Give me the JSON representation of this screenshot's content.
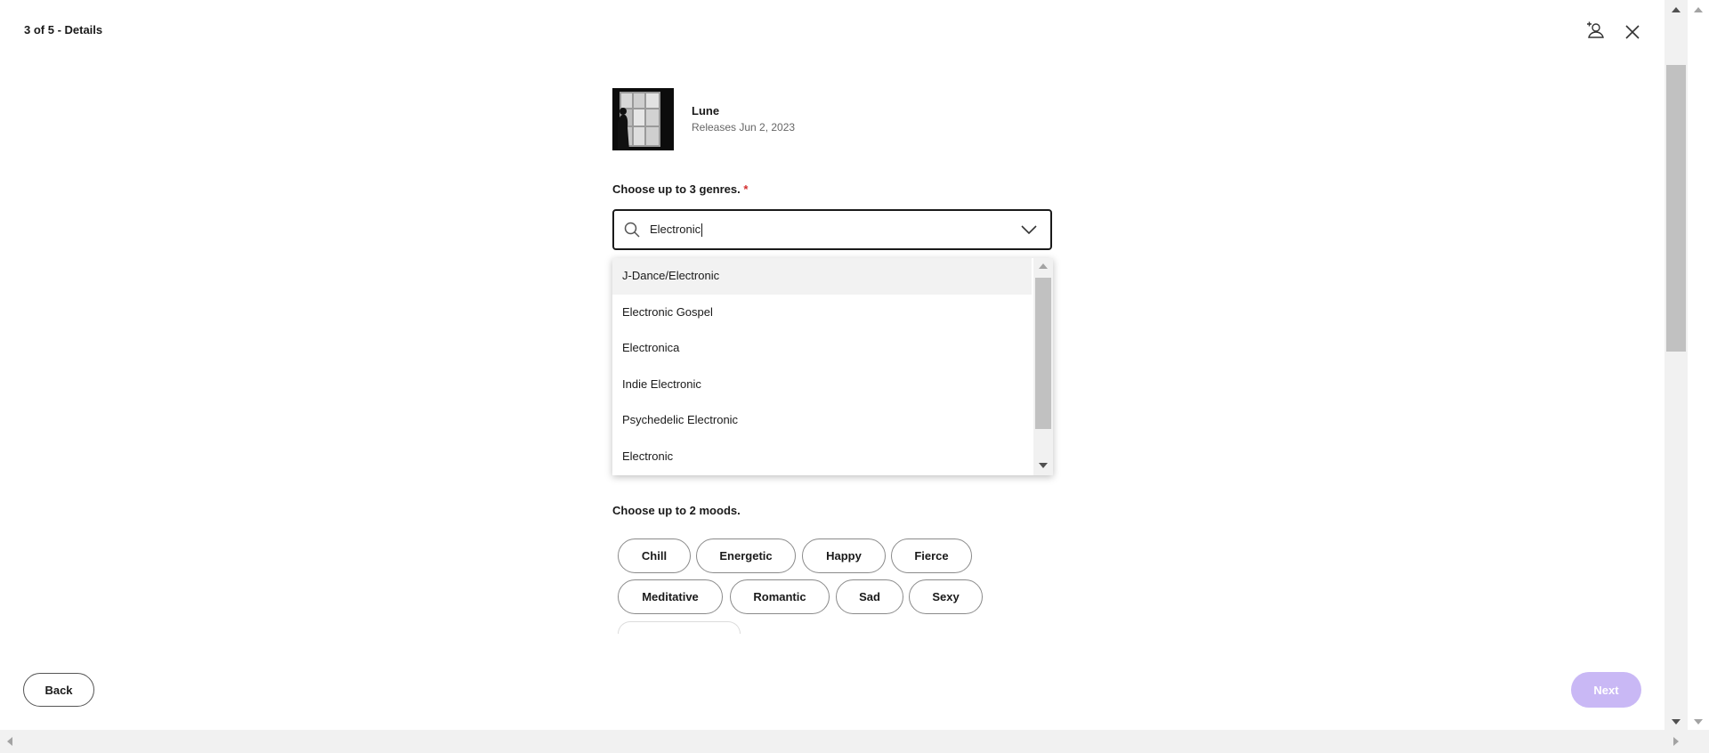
{
  "header": {
    "step_title": "3 of 5 - Details"
  },
  "release": {
    "name": "Lune",
    "date": "Releases Jun 2, 2023"
  },
  "genres": {
    "label": "Choose up to 3 genres.",
    "required_mark": "*",
    "search_value": "Electronic",
    "options": [
      "J-Dance/Electronic",
      "Electronic Gospel",
      "Electronica",
      "Indie Electronic",
      "Psychedelic Electronic",
      "Electronic"
    ],
    "hovered_index": 0
  },
  "moods": {
    "label": "Choose up to 2 moods.",
    "items": [
      "Chill",
      "Energetic",
      "Happy",
      "Fierce",
      "Meditative",
      "Romantic",
      "Sad",
      "Sexy"
    ]
  },
  "footer": {
    "back_label": "Back",
    "next_label": "Next"
  },
  "colors": {
    "accent_disabled": "#c9b8f5",
    "required": "#d32f2f"
  },
  "icons": {
    "invite": "add-person-icon",
    "close": "close-icon",
    "search": "search-icon",
    "dropdown": "chevron-down-icon"
  }
}
